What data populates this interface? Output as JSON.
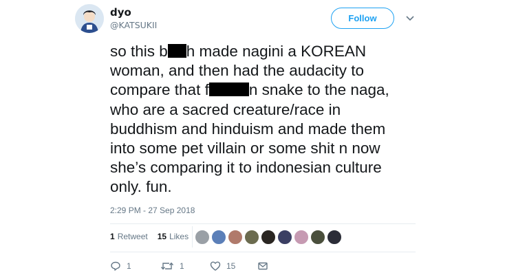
{
  "tweet": {
    "author": {
      "display_name": "dyo",
      "handle": "@KATSUKII",
      "avatar_icon": "avatar-icon"
    },
    "follow_label": "Follow",
    "text_lines": [
      [
        "so this b",
        "h made nagini a KOREAN"
      ],
      [
        "woman, and then had the audacity to"
      ],
      [
        "compare that f",
        "n snake to the naga,"
      ],
      [
        "who are a sacred creature/race in"
      ],
      [
        "buddhism and hinduism and made them"
      ],
      [
        "into some pet villain or some shit n now"
      ],
      [
        "she’s comparing it to indonesian culture"
      ],
      [
        "only. fun."
      ]
    ],
    "timestamp": "2:29 PM - 27 Sep 2018",
    "stats": {
      "retweets_count": "1",
      "retweets_label": "Retweet",
      "likes_count": "15",
      "likes_label": "Likes"
    },
    "actions": {
      "reply_count": "1",
      "retweet_count": "1",
      "like_count": "15"
    },
    "colors": {
      "accent": "#1da1f2",
      "text": "#14171a",
      "muted": "#657786",
      "divider": "#e6ecf0",
      "censor": "#000000"
    },
    "liker_avatars": [
      "#9aa0a6",
      "#5b7fb8",
      "#b07a6b",
      "#6b6b4f",
      "#2a2622",
      "#3b3f63",
      "#c69ab2",
      "#4a4f3c",
      "#2b2d38"
    ]
  }
}
